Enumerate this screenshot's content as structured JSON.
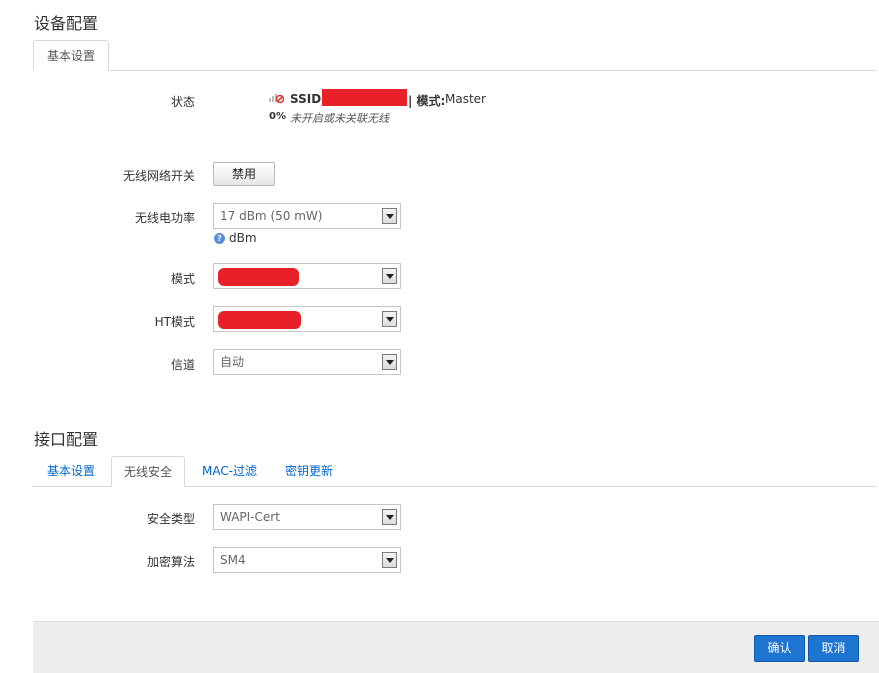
{
  "device_config": {
    "title": "设备配置",
    "tabs": [
      {
        "label": "基本设置"
      }
    ]
  },
  "status": {
    "label": "状态",
    "ssid_label": "SSID:",
    "mode_separator": "| 模式:",
    "mode_value": "Master",
    "signal_percent": "0%",
    "signal_text": "未开启或未关联无线"
  },
  "wireless_switch": {
    "label": "无线网络开关",
    "button_label": "禁用"
  },
  "tx_power": {
    "label": "无线电功率",
    "value": "17 dBm (50 mW)",
    "hint": "dBm"
  },
  "mode": {
    "label": "模式"
  },
  "ht_mode": {
    "label": "HT模式"
  },
  "channel": {
    "label": "信道",
    "value": "自动"
  },
  "interface_config": {
    "title": "接口配置",
    "tabs": [
      {
        "label": "基本设置"
      },
      {
        "label": "无线安全"
      },
      {
        "label": "MAC-过滤"
      },
      {
        "label": "密钥更新"
      }
    ]
  },
  "security_type": {
    "label": "安全类型",
    "value": "WAPI-Cert"
  },
  "cipher": {
    "label": "加密算法",
    "value": "SM4"
  },
  "footer": {
    "confirm_label": "确认",
    "cancel_label": "取消"
  },
  "colors": {
    "accent": "#1d74d1",
    "redaction": "#e8202a",
    "link": "#0066cc"
  }
}
